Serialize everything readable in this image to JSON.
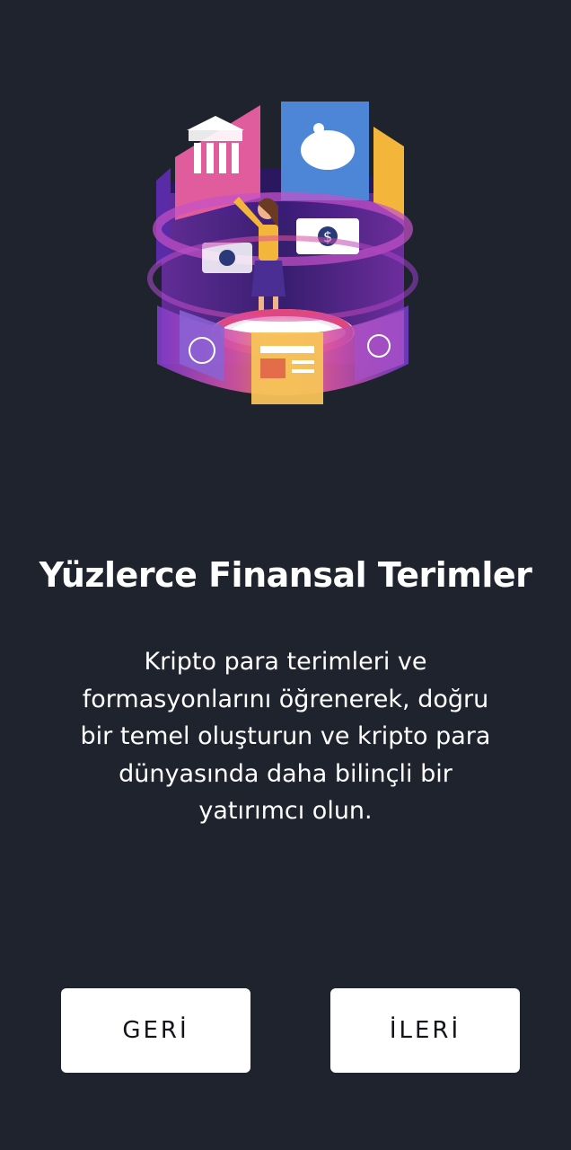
{
  "onboarding": {
    "illustration_icon": "finance-cylinder-illustration",
    "title": "Yüzlerce Finansal Terimler",
    "description": "Kripto para terimleri ve formasyonlarını öğrenerek, doğru bir temel oluşturun ve kripto para dünyasında daha bilinçli bir yatırımcı olun.",
    "back_label": "GERİ",
    "next_label": "İLERİ"
  },
  "colors": {
    "background": "#1f232d",
    "button_bg": "#ffffff",
    "button_text": "#111318"
  }
}
